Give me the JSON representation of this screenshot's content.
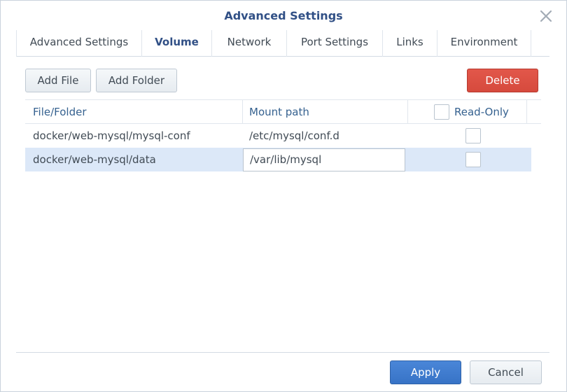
{
  "dialog": {
    "title": "Advanced Settings",
    "close_icon": "close-icon"
  },
  "tabs": [
    {
      "label": "Advanced Settings",
      "active": false
    },
    {
      "label": "Volume",
      "active": true
    },
    {
      "label": "Network",
      "active": false
    },
    {
      "label": "Port Settings",
      "active": false
    },
    {
      "label": "Links",
      "active": false
    },
    {
      "label": "Environment",
      "active": false
    }
  ],
  "toolbar": {
    "add_file": "Add File",
    "add_folder": "Add Folder",
    "delete": "Delete"
  },
  "table": {
    "columns": [
      "File/Folder",
      "Mount path",
      "Read-Only"
    ],
    "header_readonly_checked": false,
    "rows": [
      {
        "file": "docker/web-mysql/mysql-conf",
        "mount": "/etc/mysql/conf.d",
        "readonly": false,
        "selected": false
      },
      {
        "file": "docker/web-mysql/data",
        "mount": "/var/lib/mysql",
        "readonly": false,
        "selected": true
      }
    ]
  },
  "footer": {
    "apply": "Apply",
    "cancel": "Cancel"
  },
  "colors": {
    "accent": "#315086",
    "danger": "#d9503f",
    "primary": "#3f7ccf",
    "selected_row": "#dce8f8"
  }
}
